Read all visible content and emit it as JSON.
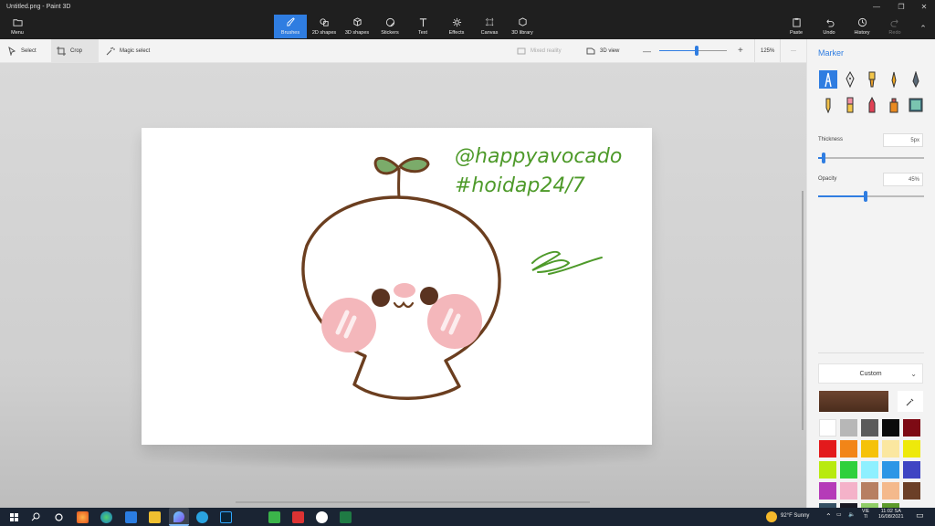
{
  "window": {
    "title": "Untitled.png - Paint 3D",
    "controls": [
      "minimize-icon",
      "restore-icon",
      "close-icon"
    ]
  },
  "ribbon": {
    "menu": "Menu",
    "tools": [
      {
        "label": "Brushes",
        "icon": "brush-icon",
        "active": true
      },
      {
        "label": "2D shapes",
        "icon": "2d-shapes-icon",
        "active": false
      },
      {
        "label": "3D shapes",
        "icon": "3d-shapes-icon",
        "active": false
      },
      {
        "label": "Stickers",
        "icon": "stickers-icon",
        "active": false
      },
      {
        "label": "Text",
        "icon": "text-icon",
        "active": false
      },
      {
        "label": "Effects",
        "icon": "effects-icon",
        "active": false
      },
      {
        "label": "Canvas",
        "icon": "canvas-icon",
        "active": false
      },
      {
        "label": "3D library",
        "icon": "3d-library-icon",
        "active": false
      }
    ],
    "right": [
      {
        "label": "Paste",
        "icon": "paste-icon",
        "enabled": true
      },
      {
        "label": "Undo",
        "icon": "undo-icon",
        "enabled": true
      },
      {
        "label": "History",
        "icon": "history-icon",
        "enabled": true
      },
      {
        "label": "Redo",
        "icon": "redo-icon",
        "enabled": false
      }
    ]
  },
  "toolbar": {
    "select": "Select",
    "crop": "Crop",
    "magic_select": "Magic select",
    "mixed_reality": "Mixed reality",
    "view_3d": "3D view",
    "zoom": "125%",
    "zoom_level": 0.55,
    "more": "···"
  },
  "canvas": {
    "handle_line1": "@happyavocado",
    "handle_line2": "#hoidap24/7",
    "signature": "signature",
    "colors": {
      "outline": "#6b3e1f",
      "leaf": "#7bab6a",
      "text": "#4e9a2a",
      "blush": "#f4b7bb",
      "eyes": "#5a3320"
    }
  },
  "panel": {
    "title": "Marker",
    "thickness_label": "Thickness",
    "thickness_value": "5px",
    "thickness_level": 0.05,
    "opacity_label": "Opacity",
    "opacity_value": "45%",
    "opacity_level": 0.45,
    "color_mode": "Custom",
    "current_color": "#6d4530",
    "brushes": [
      "marker-icon",
      "calligraphy-pen-icon",
      "oil-brush-icon",
      "watercolor-icon",
      "pixel-pen-icon",
      "pencil-icon",
      "eraser-icon",
      "crayon-icon",
      "spray-can-icon",
      "fill-icon"
    ],
    "palette": [
      "#ffffff",
      "#b7b7b7",
      "#5b5b5b",
      "#0b0b0b",
      "#7d0a14",
      "#e31a1c",
      "#f28518",
      "#f5c20a",
      "#fbe7a0",
      "#eee90b",
      "#b8ea0f",
      "#2fd03c",
      "#8ef0ff",
      "#2d96e6",
      "#3f45c3",
      "#b53bb8",
      "#f4b2c9",
      "#b77f62",
      "#f4b98c",
      "#6b3f27",
      "#355063",
      "#1a1a24",
      "#8fcd67",
      "#5c9a2b"
    ]
  },
  "taskbar": {
    "weather": "92°F  Sunny",
    "lang_top": "VIE",
    "lang_bottom": "Tl",
    "time": "11:02 SA",
    "date": "16/08/2021",
    "apps": [
      "search-icon",
      "cortana-icon",
      "firefox-icon",
      "edge-icon",
      "mail-icon",
      "file-explorer-icon",
      "paint3d-icon",
      "telegram-icon",
      "photoshop-icon",
      "camtasia-icon",
      "app-icon",
      "chrome-icon",
      "excel-icon"
    ]
  }
}
